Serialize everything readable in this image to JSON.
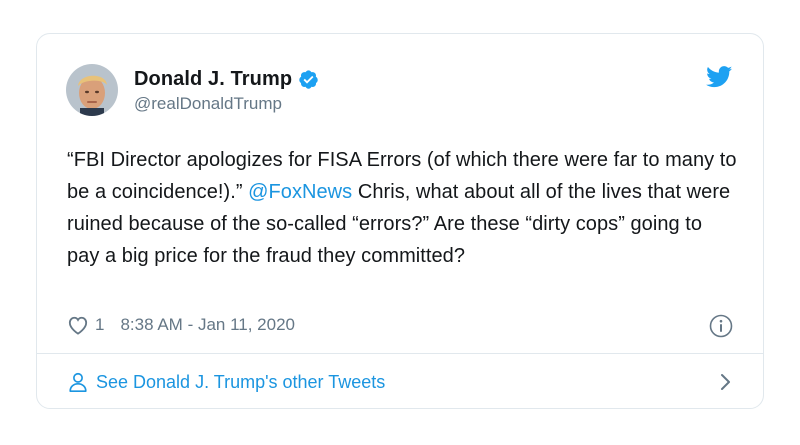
{
  "tweet": {
    "author": {
      "display_name": "Donald J. Trump",
      "handle": "@realDonaldTrump",
      "verified": true
    },
    "text": {
      "part1": "“FBI Director apologizes for FISA Errors (of which there were far to many to be a coincidence!).” ",
      "mention": "@FoxNews",
      "part2": " Chris, what about all of the lives that were ruined because of the so-called “errors?” Are these “dirty cops” going to pay a big price for the fraud they committed?"
    },
    "likes": "1",
    "timestamp": "8:38 AM - Jan 11, 2020"
  },
  "footer": {
    "label": "See Donald J. Trump's other Tweets"
  },
  "icons": {
    "brand": "twitter-bird-icon",
    "verified": "verified-badge-icon",
    "like": "heart-icon",
    "info": "info-icon",
    "profile": "person-icon",
    "chevron": "chevron-right-icon"
  },
  "colors": {
    "brand_blue": "#1da1f2",
    "link_blue": "#1b95e0",
    "text": "#14171a",
    "muted": "#657786",
    "border": "#e1e8ed"
  }
}
